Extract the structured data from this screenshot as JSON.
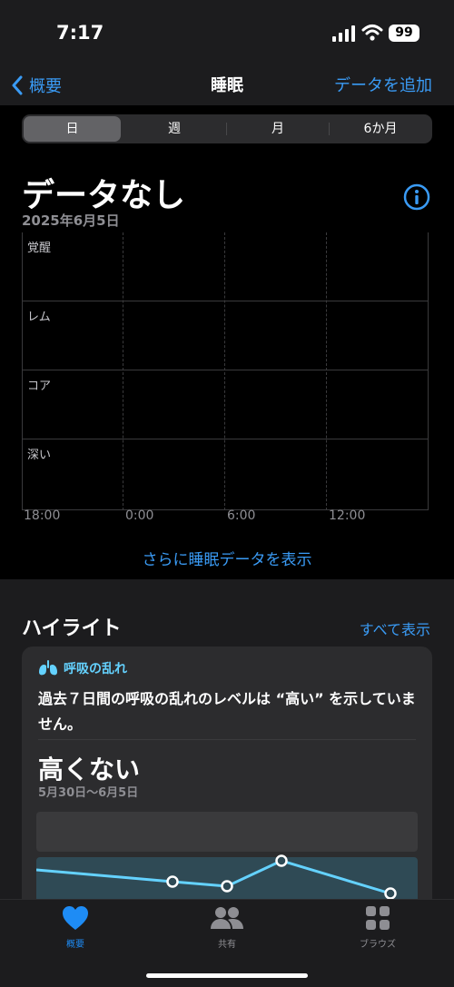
{
  "status": {
    "time": "7:17",
    "battery": "99"
  },
  "nav": {
    "back_label": "概要",
    "title": "睡眠",
    "add_label": "データを追加"
  },
  "segments": [
    "日",
    "週",
    "月",
    "6か月"
  ],
  "summary": {
    "title": "データなし",
    "date": "2025年6月5日"
  },
  "sleep_chart": {
    "stages": [
      "覚醒",
      "レム",
      "コア",
      "深い"
    ],
    "x_ticks": [
      "18:00",
      "0:00",
      "6:00",
      "12:00"
    ]
  },
  "more_link": "さらに睡眠データを表示",
  "highlights": {
    "title": "ハイライト",
    "show_all": "すべて表示",
    "card": {
      "category": "呼吸の乱れ",
      "body": "過去７日間の呼吸の乱れのレベルは “高い” を示していません。",
      "value": "高くない",
      "range": "5月30日〜6月5日"
    }
  },
  "tabs": [
    {
      "label": "概要",
      "icon": "heart-icon"
    },
    {
      "label": "共有",
      "icon": "people-icon"
    },
    {
      "label": "ブラウズ",
      "icon": "grid-icon"
    }
  ],
  "colors": {
    "accent": "#3a9bf5",
    "breathing": "#64d2ff",
    "heart": "#1e8cf5"
  }
}
